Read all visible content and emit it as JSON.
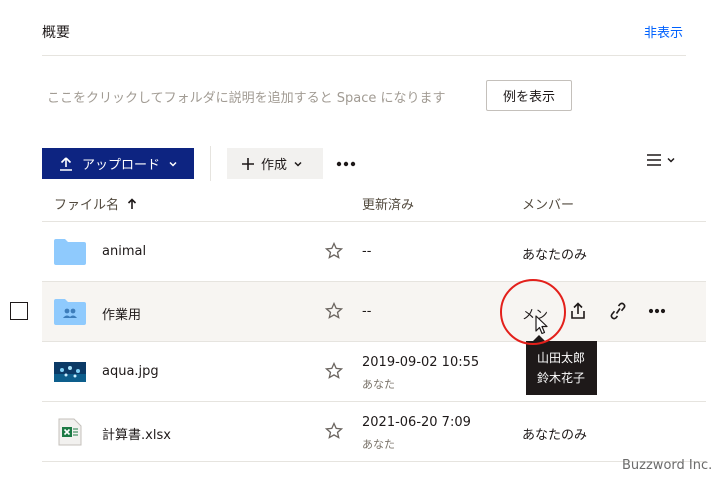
{
  "overview": {
    "title": "概要",
    "hide_link": "非表示",
    "description_hint": "ここをクリックしてフォルダに説明を追加すると Space になります",
    "example_button": "例を表示"
  },
  "toolbar": {
    "upload_label": "アップロード",
    "create_label": "作成",
    "more_glyph": "•••"
  },
  "columns": {
    "name": "ファイル名",
    "modified": "更新済み",
    "members": "メンバー"
  },
  "rows": [
    {
      "name": "animal",
      "modified": "--",
      "modified_by": "",
      "members": "あなたのみ",
      "icon": "folder-icon"
    },
    {
      "name": "作業用",
      "modified": "--",
      "modified_by": "",
      "members": "メン",
      "icon": "shared-folder-icon"
    },
    {
      "name": "aqua.jpg",
      "modified": "2019-09-02 10:55",
      "modified_by": "あなた",
      "members": "",
      "icon": "image-thumbnail"
    },
    {
      "name": "計算書.xlsx",
      "modified": "2021-06-20 7:09",
      "modified_by": "あなた",
      "members": "あなたのみ",
      "icon": "excel-icon"
    }
  ],
  "tooltip": {
    "lines": [
      "山田太郎",
      "鈴木花子"
    ]
  },
  "watermark": "Buzzword Inc.",
  "colors": {
    "primary": "#0d2481",
    "link": "#0061fe",
    "folder": "#8fcafd",
    "highlight_circle": "#e3201b"
  }
}
